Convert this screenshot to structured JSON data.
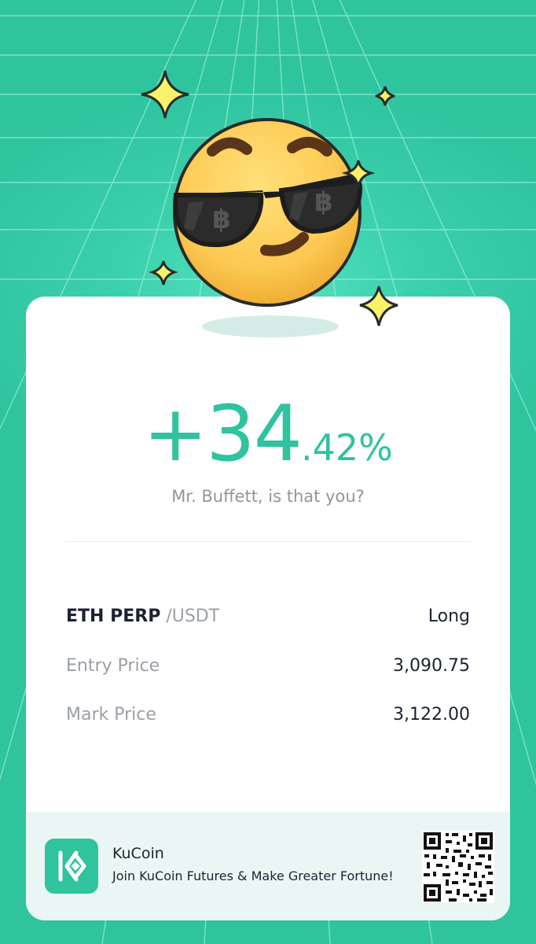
{
  "pnl": {
    "integer": "+34",
    "decimal": ".42%"
  },
  "caption": "Mr. Buffett, is that you?",
  "position": {
    "pair_base": "ETH PERP",
    "pair_quote": "/USDT",
    "side": "Long",
    "entry_label": "Entry Price",
    "entry_value": "3,090.75",
    "mark_label": "Mark Price",
    "mark_value": "3,122.00"
  },
  "footer": {
    "brand": "KuCoin",
    "tagline": "Join KuCoin Futures & Make Greater Fortune!"
  },
  "colors": {
    "accent": "#2fc39e",
    "background": "#3bd0ac"
  },
  "icons": [
    "sunglasses-emoji-icon",
    "sparkle-icon",
    "kucoin-logo-icon",
    "qr-code-icon"
  ]
}
